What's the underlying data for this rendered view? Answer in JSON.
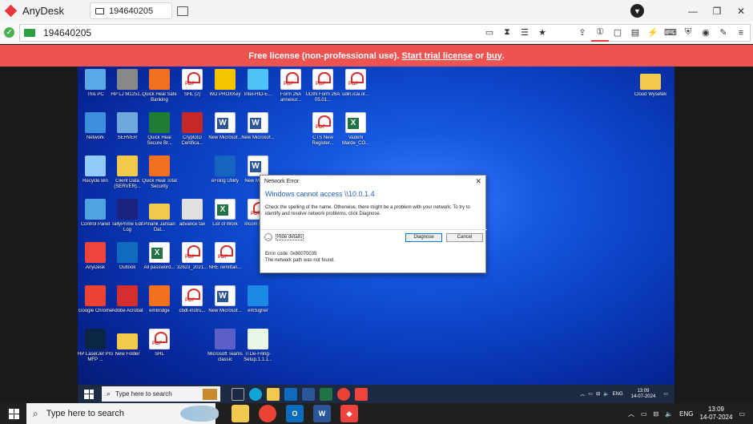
{
  "anydesk": {
    "app_name": "AnyDesk",
    "tab_label": "194640205",
    "address_value": "194640205",
    "banner": {
      "prefix": "Free license (non-professional use).",
      "link1": "Start trial license",
      "middle": "or",
      "link2": "buy",
      "suffix": "."
    }
  },
  "desktop_icons": [
    {
      "label": "This PC",
      "kind": "generic",
      "color": "#5aa9e6"
    },
    {
      "label": "HP LJ M1251...",
      "kind": "generic",
      "color": "#888888"
    },
    {
      "label": "Quick Heal Safe Banking",
      "kind": "generic",
      "color": "#f37021"
    },
    {
      "label": "SHL (2)",
      "kind": "pdf",
      "color": ""
    },
    {
      "label": "WD PROXKey",
      "kind": "generic",
      "color": "#f5c400"
    },
    {
      "label": "Intel-HID-E...",
      "kind": "generic",
      "color": "#4fc3f7"
    },
    {
      "label": "Form 26A annexur...",
      "kind": "pdf",
      "color": ""
    },
    {
      "label": "UDIN Form 26A 05.01...",
      "kind": "pdf",
      "color": ""
    },
    {
      "label": "udin.icai.or...",
      "kind": "pdf",
      "color": ""
    },
    {
      "label": "Network",
      "kind": "generic",
      "color": "#3e8ede"
    },
    {
      "label": "SERVER",
      "kind": "generic",
      "color": "#6fa8dc"
    },
    {
      "label": "Quick Heal Secure Br...",
      "kind": "generic",
      "color": "#1e7d32"
    },
    {
      "label": "CryptoID Certifica...",
      "kind": "generic",
      "color": "#c62828"
    },
    {
      "label": "New Microsof...",
      "kind": "word",
      "color": ""
    },
    {
      "label": "New Microsof...",
      "kind": "word",
      "color": ""
    },
    {
      "label": "CTS New Register...",
      "kind": "pdf",
      "color": ""
    },
    {
      "label": "Vadehi Marde_CO...",
      "kind": "excel",
      "color": ""
    },
    {
      "label": "Recycle Bin",
      "kind": "generic",
      "color": "#90caf9"
    },
    {
      "label": "Client Data (SERVER)...",
      "kind": "generic",
      "color": "#f2c94c"
    },
    {
      "label": "Quick Heal Total Security",
      "kind": "generic",
      "color": "#f37021"
    },
    {
      "label": "eFiling Utility",
      "kind": "generic",
      "color": "#1565c0"
    },
    {
      "label": "New Micro...",
      "kind": "word",
      "color": ""
    },
    {
      "label": "Control Panel",
      "kind": "generic",
      "color": "#4fa3e0"
    },
    {
      "label": "TallyPrime Edit Log",
      "kind": "generic",
      "color": "#1a237e"
    },
    {
      "label": "Pinank Jansari Dat...",
      "kind": "folder",
      "color": ""
    },
    {
      "label": "advance tax",
      "kind": "generic",
      "color": "#e0e0e0"
    },
    {
      "label": "List of Work",
      "kind": "excel",
      "color": ""
    },
    {
      "label": "Incom Portal",
      "kind": "pdf",
      "color": ""
    },
    {
      "label": "AnyDesk",
      "kind": "generic",
      "color": "#ef443b"
    },
    {
      "label": "Outlook",
      "kind": "generic",
      "color": "#0f6cbd"
    },
    {
      "label": "All password...",
      "kind": "excel",
      "color": ""
    },
    {
      "label": "32623_2021...",
      "kind": "pdf",
      "color": ""
    },
    {
      "label": "NRE remittan...",
      "kind": "pdf",
      "color": ""
    },
    {
      "label": "Google Chrome",
      "kind": "generic",
      "color": "#ea4335"
    },
    {
      "label": "Adobe Acrobat",
      "kind": "generic",
      "color": "#d32f2f"
    },
    {
      "label": "emBridge",
      "kind": "generic",
      "color": "#f37021"
    },
    {
      "label": "cbdt-instru...",
      "kind": "pdf",
      "color": ""
    },
    {
      "label": "New Microsof...",
      "kind": "word",
      "color": ""
    },
    {
      "label": "emSigner",
      "kind": "generic",
      "color": "#1e88e5"
    },
    {
      "label": "HP LaserJet Pro MFP ...",
      "kind": "generic",
      "color": "#0b2545"
    },
    {
      "label": "New Folder",
      "kind": "folder",
      "color": ""
    },
    {
      "label": "SHL",
      "kind": "pdf",
      "color": ""
    },
    {
      "label": "Microsoft Teams classic",
      "kind": "generic",
      "color": "#5b5fc7"
    },
    {
      "label": "ITDe-Filing-Setup.1.1.1...",
      "kind": "generic",
      "color": "#e8f5e9"
    },
    {
      "label": "Cloud Wysetek",
      "kind": "folder",
      "color": ""
    }
  ],
  "dialog": {
    "title": "Network Error",
    "heading": "Windows cannot access \\\\10.0.1.4",
    "message": "Check the spelling of the name. Otherwise, there might be a problem with your network. To try to identify and resolve network problems, click Diagnose.",
    "hide_details": "Hide details",
    "diagnose": "Diagnose",
    "cancel": "Cancel",
    "error_code": "Error code: 0x80070035",
    "error_text": "The network path was not found."
  },
  "remote_taskbar": {
    "search_placeholder": "Type here to search",
    "lang": "ENG",
    "time": "13:09",
    "date": "14-07-2024"
  },
  "local_taskbar": {
    "search_placeholder": "Type here to search",
    "lang": "ENG",
    "time": "13:09",
    "date": "14-07-2024"
  }
}
